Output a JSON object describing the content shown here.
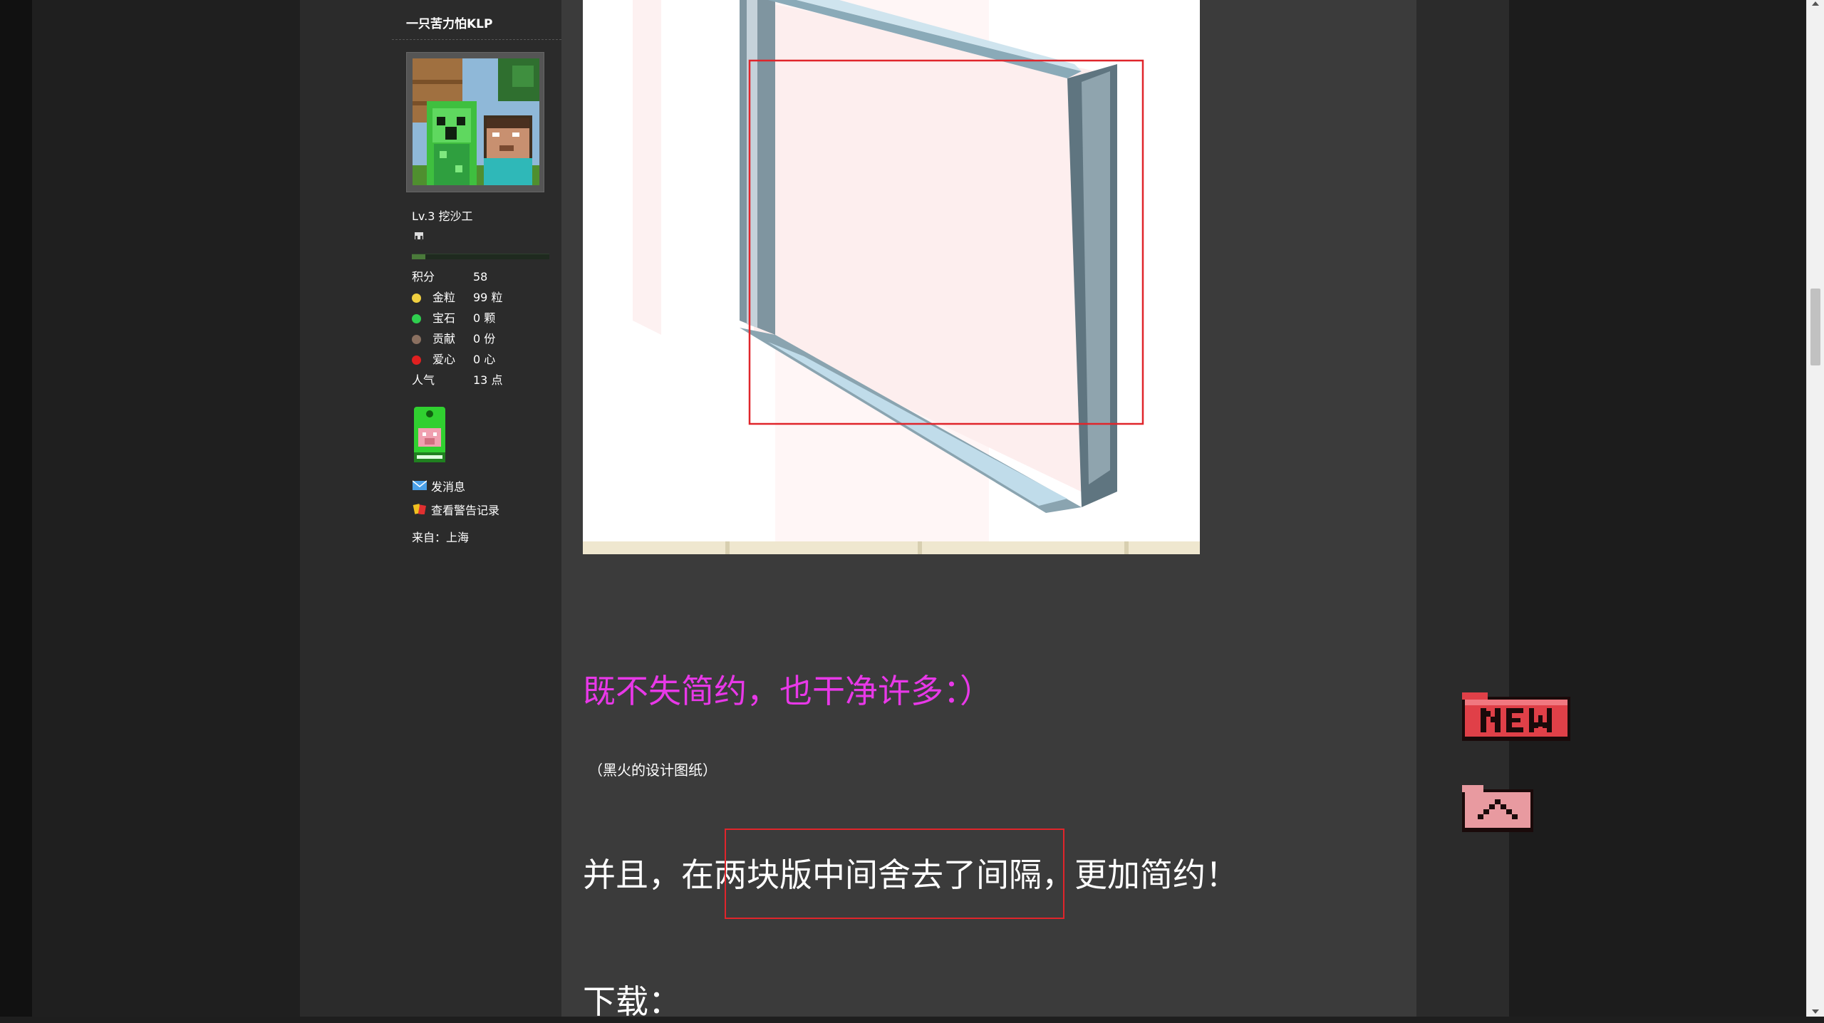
{
  "user": {
    "name": "一只苦力怕KLP",
    "level": "Lv.3 挖沙工",
    "level_progress": 0.1,
    "stats": [
      {
        "label": "积分",
        "value": "58",
        "icon": "",
        "color": ""
      },
      {
        "label": "金粒",
        "value": "99 粒",
        "icon": "gold-nugget-icon",
        "color": "#f0d040"
      },
      {
        "label": "宝石",
        "value": "0 颗",
        "icon": "emerald-icon",
        "color": "#2fcf4f"
      },
      {
        "label": "贡献",
        "value": "0 份",
        "icon": "contribution-icon",
        "color": "#8a7060"
      },
      {
        "label": "爱心",
        "value": "0 心",
        "icon": "heart-icon",
        "color": "#e02020"
      },
      {
        "label": "人气",
        "value": "13 点",
        "icon": "",
        "color": ""
      }
    ],
    "actions": {
      "send_message": "发消息",
      "view_warnings": "查看警告记录"
    },
    "location": "来自：上海"
  },
  "post": {
    "headline": "既不失简约，也干净许多：）",
    "caption": "（黑火的设计图纸）",
    "paragraph": "并且，在两块版中间舍去了间隔，更加简约！",
    "download": "下载："
  },
  "colors": {
    "headline": "#e838e8",
    "highlight_box": "#e0252b",
    "new_button": "#e04048"
  }
}
